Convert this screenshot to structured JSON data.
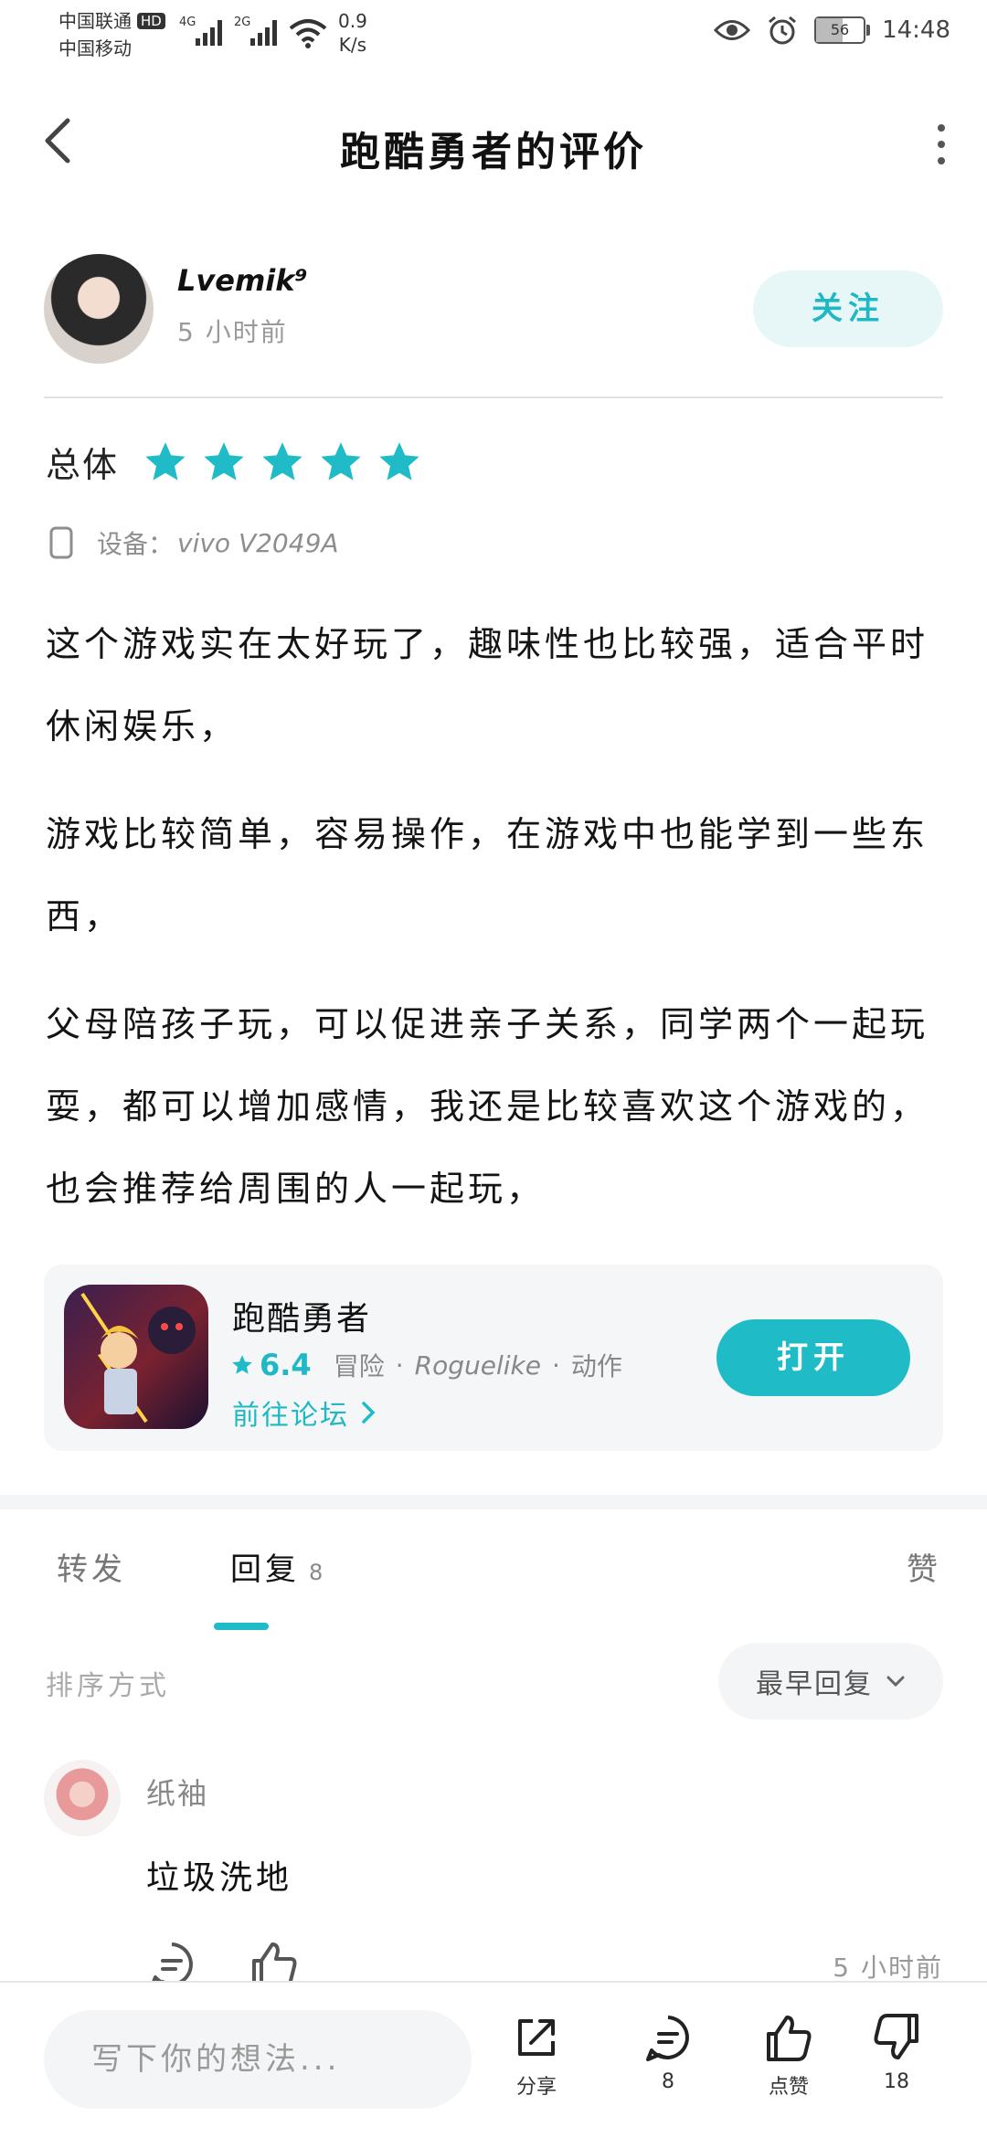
{
  "status_bar": {
    "carrier1": "中国联通",
    "hd_badge": "HD",
    "carrier2": "中国移动",
    "signal1_label": "4G",
    "signal2_label": "2G",
    "net_speed_value": "0.9",
    "net_speed_unit": "K/s",
    "battery": "56",
    "battery_level": 0.56,
    "time": "14:48"
  },
  "header": {
    "title": "跑酷勇者的评价"
  },
  "author": {
    "name": "Lvemik⁹",
    "time": "5 小时前",
    "follow_label": "关注"
  },
  "rating": {
    "label": "总体",
    "stars": 5,
    "max_stars": 5
  },
  "device": {
    "label": "设备：",
    "model": "vivo V2049A"
  },
  "review": {
    "paragraphs": [
      "这个游戏实在太好玩了，趣味性也比较强，适合平时休闲娱乐，",
      "游戏比较简单，容易操作，在游戏中也能学到一些东西，",
      "父母陪孩子玩，可以促进亲子关系，同学两个一起玩耍，都可以增加感情，我还是比较喜欢这个游戏的，也会推荐给周围的人一起玩，"
    ]
  },
  "app_card": {
    "name": "跑酷勇者",
    "score": "6.4",
    "tags": [
      "冒险",
      "Roguelike",
      "动作"
    ],
    "forum_link": "前往论坛",
    "open_label": "打开"
  },
  "tabs": {
    "repost": "转发",
    "reply": "回复",
    "reply_count": "8",
    "like": "赞"
  },
  "sort": {
    "label": "排序方式",
    "selected": "最早回复"
  },
  "comment": {
    "user": "纸袖",
    "text": "垃圾洗地",
    "time": "5 小时前"
  },
  "bottom_bar": {
    "composer_placeholder": "写下你的想法...",
    "share_label": "分享",
    "comment_count": "8",
    "like_label": "点赞",
    "dislike_count": "18"
  },
  "colors": {
    "accent": "#1fbcc8",
    "follow_bg": "#e7f7f8",
    "card_bg": "#f4f6f8"
  }
}
